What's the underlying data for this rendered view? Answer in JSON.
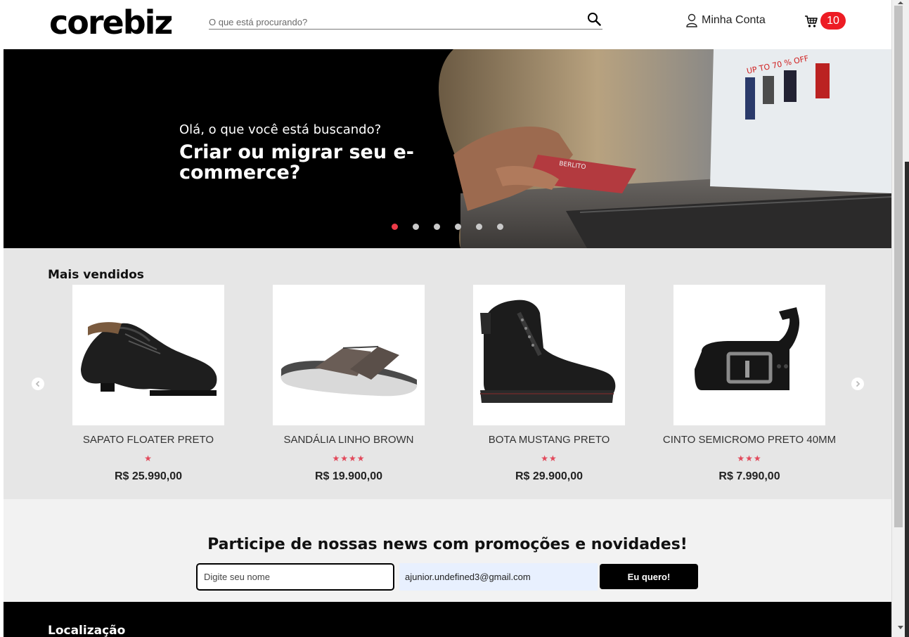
{
  "header": {
    "logo": "corebiz",
    "search_placeholder": "O que está procurando?",
    "account_label": "Minha Conta",
    "cart_count": "10"
  },
  "hero": {
    "subtitle": "Olá, o que você está buscando?",
    "title": "Criar ou migrar seu e-commerce?",
    "slide_count": 6,
    "active_slide": 1
  },
  "bestsellers": {
    "title": "Mais vendidos",
    "products": [
      {
        "name": "SAPATO FLOATER PRETO",
        "stars": "★",
        "rating": 1,
        "price": "R$ 25.990,00"
      },
      {
        "name": "SANDÁLIA LINHO BROWN",
        "stars": "★★★★",
        "rating": 4,
        "price": "R$ 19.900,00"
      },
      {
        "name": "BOTA MUSTANG PRETO",
        "stars": "★★",
        "rating": 2,
        "price": "R$ 29.900,00"
      },
      {
        "name": "CINTO SEMICROMO PRETO 40MM",
        "stars": "★★★",
        "rating": 3,
        "price": "R$ 7.990,00"
      }
    ]
  },
  "newsletter": {
    "title": "Participe de nossas news com promoções e novidades!",
    "name_placeholder": "Digite seu nome",
    "email_value": "ajunior.undefined3@gmail.com",
    "button_label": "Eu quero!"
  },
  "footer": {
    "title": "Localização"
  },
  "colors": {
    "accent": "#ed3b48",
    "cart_badge": "#ed1c24",
    "star": "#e2485a"
  }
}
